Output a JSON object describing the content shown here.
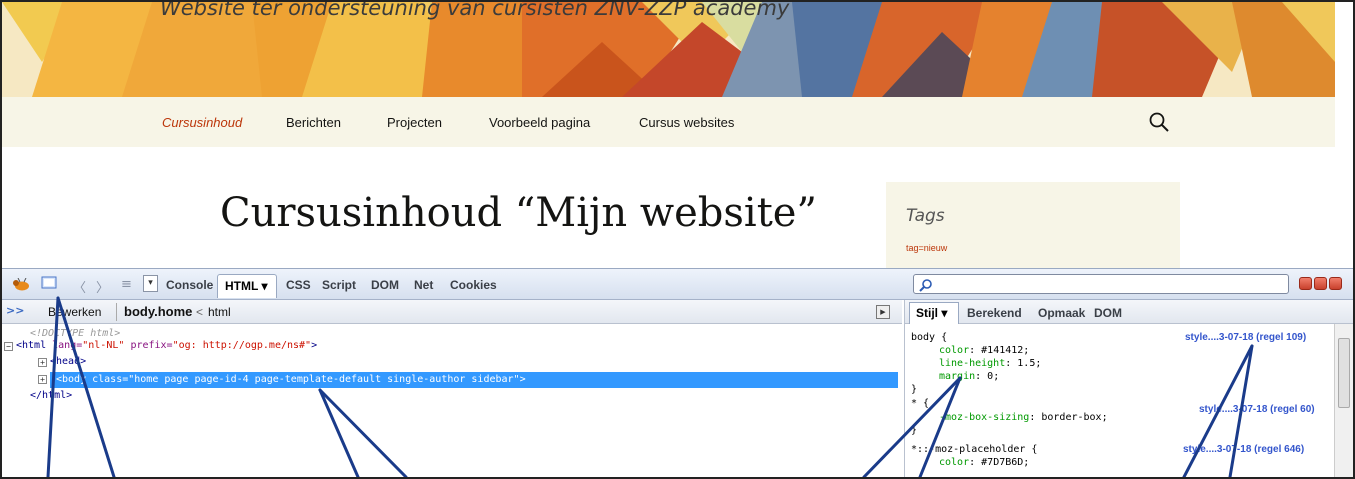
{
  "website": {
    "tagline": "Website ter ondersteuning van cursisten ZNV-ZZP academy",
    "nav": [
      {
        "label": "Cursusinhoud",
        "active": true
      },
      {
        "label": "Berichten",
        "active": false
      },
      {
        "label": "Projecten",
        "active": false
      },
      {
        "label": "Voorbeeld pagina",
        "active": false
      },
      {
        "label": "Cursus websites",
        "active": false
      }
    ],
    "page_title": "Cursusinhoud “Mijn website”",
    "sidebar": {
      "title": "Tags",
      "tag": "tag=nieuw"
    },
    "colors": {
      "accent": "#bc360a",
      "nav_bg": "#f7f5e7",
      "text": "#141412"
    }
  },
  "firebug": {
    "tabs": [
      "Console",
      "HTML",
      "CSS",
      "Script",
      "DOM",
      "Net",
      "Cookies"
    ],
    "active_tab": "HTML",
    "active_tab_label": "HTML ▾",
    "search_placeholder": "",
    "html_bar": {
      "edit": "Bewerken",
      "crumb_active": "body.home",
      "crumb_sep": "<",
      "crumb_parent": "html"
    },
    "tree": {
      "doctype": "<!DOCTYPE html>",
      "html_open_tag": "<html",
      "html_lang_attr": "lang=",
      "html_lang_val": "\"nl-NL\"",
      "html_prefix_attr": "prefix=",
      "html_prefix_val": "\"og: http://ogp.me/ns#\"",
      "html_close_bracket": ">",
      "head": "<head>",
      "body": "<body class=\"home page page-id-4 page-template-default single-author sidebar\">",
      "html_close": "</html>"
    },
    "side_tabs": [
      "Stijl ▾",
      "Berekend",
      "Opmaak",
      "DOM"
    ],
    "css_rules": [
      {
        "selector": "body {",
        "source": "style....3-07-18 (regel 109)",
        "props": [
          {
            "name": "color",
            "value": "#141412;"
          },
          {
            "name": "line-height",
            "value": "1.5;"
          },
          {
            "name": "margin",
            "value": "0;"
          }
        ]
      },
      {
        "selector": "* {",
        "source": "style....3-07-18 (regel 60)",
        "props": [
          {
            "name": "-moz-box-sizing",
            "value": "border-box;"
          }
        ]
      },
      {
        "selector": "*::-moz-placeholder {",
        "source": "style....3-07-18 (regel 646)",
        "props": [
          {
            "name": "color",
            "value": "#7D7B6D;"
          }
        ]
      }
    ],
    "closing_brace": "}"
  }
}
